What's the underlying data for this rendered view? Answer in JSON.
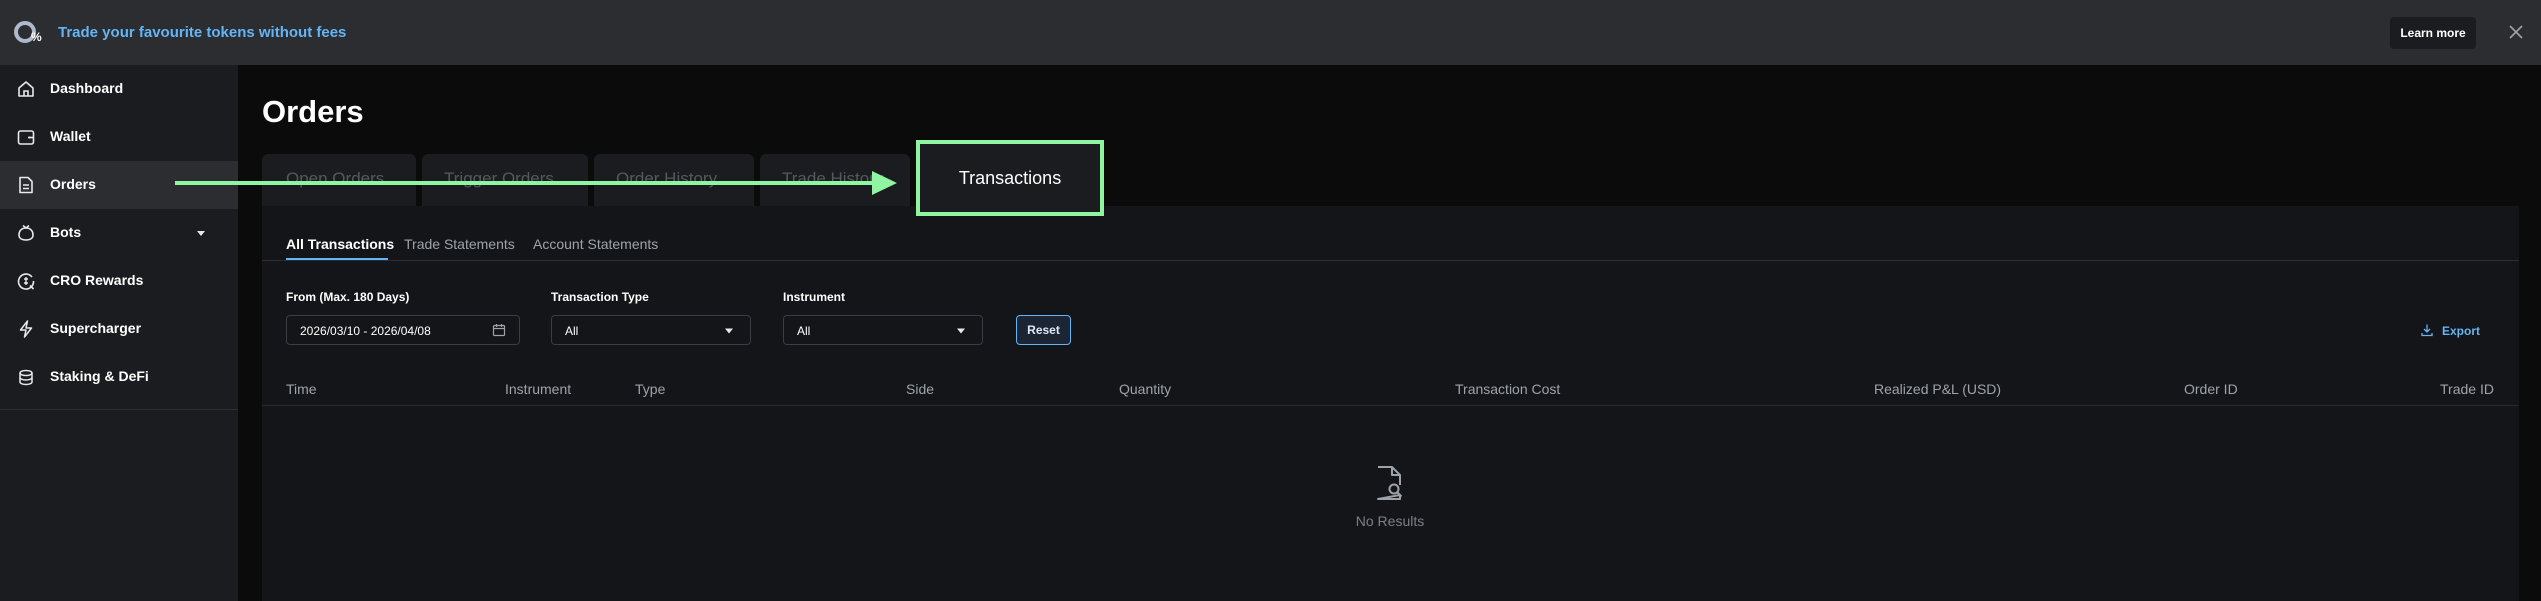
{
  "banner": {
    "logo_text": "0%",
    "message": "Trade your favourite tokens without fees",
    "learn_more_label": "Learn more",
    "close_icon": "close-icon"
  },
  "sidebar": {
    "items": [
      {
        "label": "Dashboard",
        "icon": "home-icon",
        "active": false
      },
      {
        "label": "Wallet",
        "icon": "wallet-icon",
        "active": false
      },
      {
        "label": "Orders",
        "icon": "document-icon",
        "active": true
      },
      {
        "label": "Bots",
        "icon": "bot-icon",
        "active": false,
        "has_submenu": true
      },
      {
        "label": "CRO Rewards",
        "icon": "rewards-icon",
        "active": false
      },
      {
        "label": "Supercharger",
        "icon": "lightning-icon",
        "active": false
      },
      {
        "label": "Staking & DeFi",
        "icon": "coins-stack-icon",
        "active": false
      }
    ]
  },
  "page": {
    "title": "Orders",
    "tabs": [
      {
        "label": "Open Orders"
      },
      {
        "label": "Trigger Orders"
      },
      {
        "label": "Order History"
      },
      {
        "label": "Trade History"
      },
      {
        "label": "Transactions",
        "active": true
      }
    ]
  },
  "panel": {
    "subtabs": [
      {
        "label": "All Transactions",
        "active": true
      },
      {
        "label": "Trade Statements"
      },
      {
        "label": "Account Statements"
      }
    ],
    "filters": {
      "date_label": "From (Max. 180 Days)",
      "date_value": "2026/03/10 - 2026/04/08",
      "type_label": "Transaction Type",
      "type_value": "All",
      "instrument_label": "Instrument",
      "instrument_value": "All",
      "reset_label": "Reset",
      "export_label": "Export"
    },
    "columns": [
      "Time",
      "Instrument",
      "Type",
      "Side",
      "Quantity",
      "Transaction Cost",
      "Realized P&L (USD)",
      "Order ID",
      "Trade ID"
    ],
    "empty_text": "No Results"
  },
  "colors": {
    "accent_blue": "#64b5f6",
    "highlight_green": "#8ff5a0",
    "sidebar_bg": "#1b1c1f",
    "panel_bg": "#141518"
  }
}
